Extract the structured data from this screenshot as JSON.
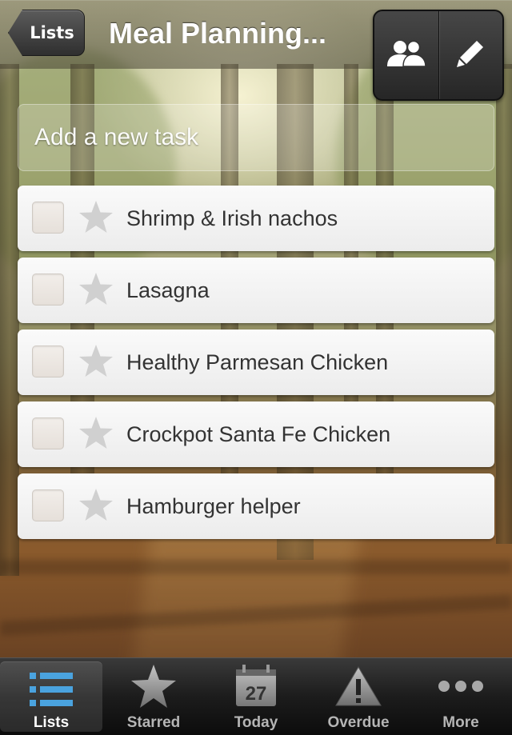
{
  "header": {
    "back_label": "Lists",
    "title": "Meal Planning...",
    "actions": [
      {
        "icon": "share-people-icon"
      },
      {
        "icon": "pencil-icon"
      }
    ]
  },
  "add_task": {
    "placeholder": "Add a new task"
  },
  "tasks": [
    {
      "label": "Shrimp & Irish nachos",
      "checked": false,
      "starred": false
    },
    {
      "label": "Lasagna",
      "checked": false,
      "starred": false
    },
    {
      "label": "Healthy Parmesan Chicken",
      "checked": false,
      "starred": false
    },
    {
      "label": "Crockpot Santa Fe Chicken",
      "checked": false,
      "starred": false
    },
    {
      "label": "Hamburger helper",
      "checked": false,
      "starred": false
    }
  ],
  "tabbar": {
    "tabs": [
      {
        "label": "Lists",
        "icon": "list-icon",
        "active": true
      },
      {
        "label": "Starred",
        "icon": "star-icon",
        "active": false
      },
      {
        "label": "Today",
        "icon": "calendar-icon",
        "calendar_day": "27",
        "active": false
      },
      {
        "label": "Overdue",
        "icon": "warning-icon",
        "active": false
      },
      {
        "label": "More",
        "icon": "more-dots-icon",
        "active": false
      }
    ]
  },
  "colors": {
    "accent": "#4aa3df",
    "tab_label": "#b5b5b5",
    "task_text": "#333333",
    "star": "#d0d0d0"
  }
}
